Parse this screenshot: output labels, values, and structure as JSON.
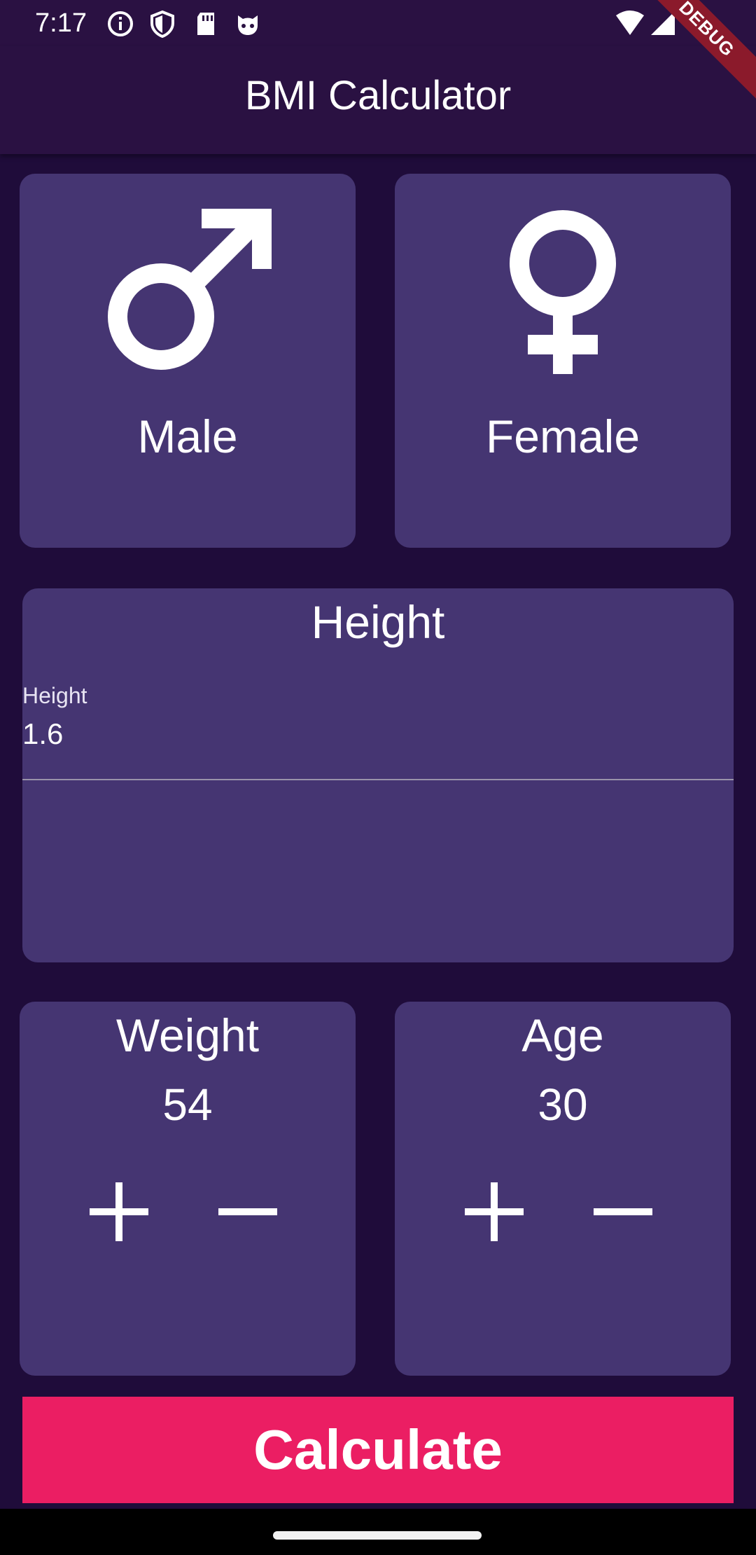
{
  "status_bar": {
    "time": "7:17",
    "icons": [
      "info-icon",
      "shield-icon",
      "sd-card-icon",
      "cat-icon",
      "wifi-icon",
      "cell-signal-icon"
    ]
  },
  "debug_banner": "DEBUG",
  "app_bar": {
    "title": "BMI Calculator"
  },
  "gender": {
    "male": {
      "label": "Male",
      "icon": "male-icon"
    },
    "female": {
      "label": "Female",
      "icon": "female-icon"
    }
  },
  "height": {
    "title": "Height",
    "field_label": "Height",
    "value": "1.6"
  },
  "weight": {
    "title": "Weight",
    "value": "54"
  },
  "age": {
    "title": "Age",
    "value": "30"
  },
  "calculate_label": "Calculate",
  "colors": {
    "background": "#1f0c3a",
    "app_bar": "#2a1142",
    "card": "#453572",
    "accent": "#eb1e63",
    "debug": "#8b1a2b"
  }
}
